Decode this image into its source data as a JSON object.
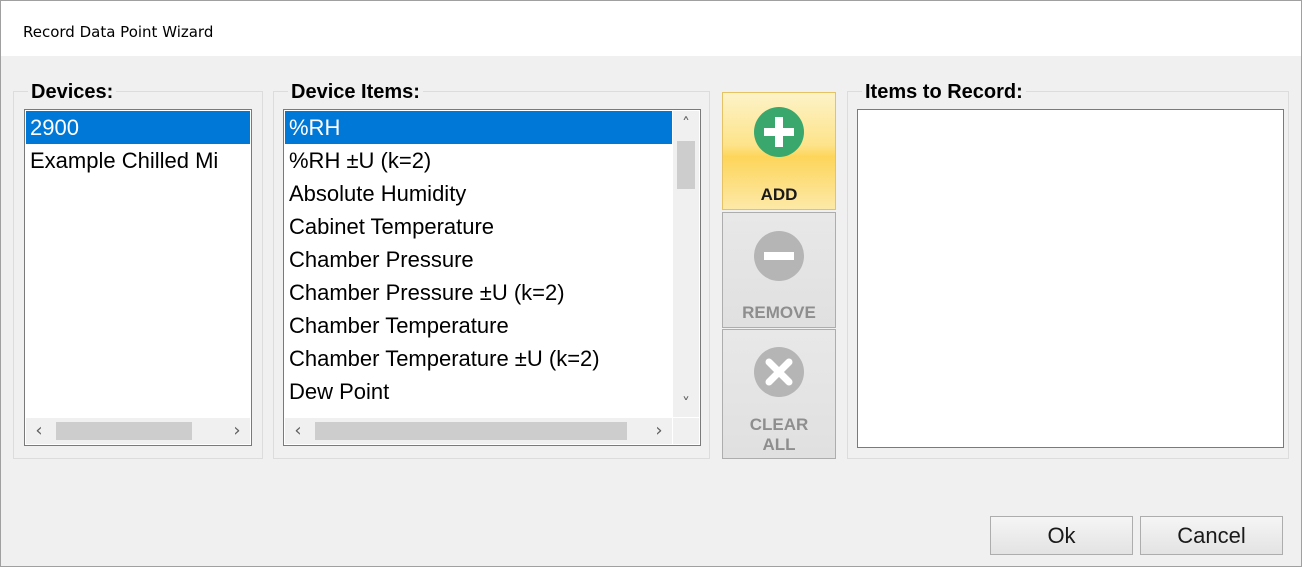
{
  "window": {
    "title": "Record Data Point Wizard"
  },
  "devices": {
    "legend": "Devices:",
    "items": [
      "2900",
      "Example Chilled Mi"
    ],
    "selected_index": 0
  },
  "device_items": {
    "legend": "Device Items:",
    "items": [
      "%RH",
      "%RH ±U (k=2)",
      "Absolute Humidity",
      "Cabinet Temperature",
      "Chamber Pressure",
      "Chamber Pressure ±U (k=2)",
      "Chamber Temperature",
      "Chamber Temperature ±U (k=2)",
      "Dew Point"
    ],
    "selected_index": 0
  },
  "actions": {
    "add_label": "ADD",
    "remove_label": "REMOVE",
    "clear_line1": "CLEAR",
    "clear_line2": "ALL"
  },
  "items_to_record": {
    "legend": "Items to Record:",
    "items": []
  },
  "footer": {
    "ok_label": "Ok",
    "cancel_label": "Cancel"
  },
  "icons": {
    "add": "plus-circle-icon",
    "remove": "minus-circle-icon",
    "clear": "x-circle-icon",
    "scroll_left": "chevron-left-icon",
    "scroll_right": "chevron-right-icon",
    "scroll_up": "chevron-up-icon",
    "scroll_down": "chevron-down-icon"
  },
  "colors": {
    "selection": "#0078d7",
    "add_icon": "#3aa76d",
    "add_button": "#fdd55a",
    "disabled_icon": "#b5b5b5",
    "disabled_text": "#8e8e8e"
  }
}
